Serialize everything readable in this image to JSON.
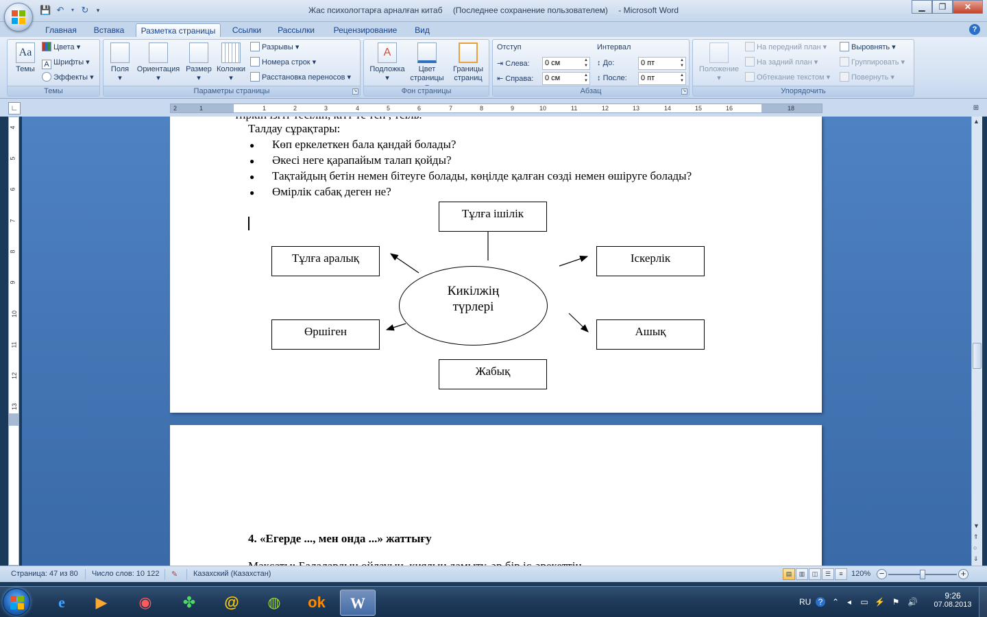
{
  "window": {
    "title_doc": "Жас психологтарға арналған   китаб",
    "title_saved": "(Последнее сохранение пользователем)",
    "title_app": "- Microsoft Word"
  },
  "tabs": [
    "Главная",
    "Вставка",
    "Разметка страницы",
    "Ссылки",
    "Рассылки",
    "Рецензирование",
    "Вид"
  ],
  "active_tab": "Разметка страницы",
  "ribbon": {
    "themes": {
      "label": "Темы",
      "btn": "Темы",
      "colors": "Цвета",
      "fonts": "Шрифты",
      "effects": "Эффекты"
    },
    "page_setup": {
      "label": "Параметры страницы",
      "margins": "Поля",
      "orientation": "Ориентация",
      "size": "Размер",
      "columns": "Колонки",
      "breaks": "Разрывы",
      "line_numbers": "Номера строк",
      "hyphenation": "Расстановка переносов"
    },
    "background": {
      "label": "Фон страницы",
      "watermark": "Подложка",
      "page_color_1": "Цвет",
      "page_color_2": "страницы",
      "page_borders_1": "Границы",
      "page_borders_2": "страниц"
    },
    "paragraph": {
      "label": "Абзац",
      "indent_title": "Отступ",
      "left_label": "Слева:",
      "left_value": "0 см",
      "right_label": "Справа:",
      "right_value": "0 см",
      "spacing_title": "Интервал",
      "before_label": "До:",
      "before_value": "0 пт",
      "after_label": "После:",
      "after_value": "0 пт"
    },
    "arrange": {
      "label": "Упорядочить",
      "position": "Положение",
      "bring_front": "На передний план",
      "send_back": "На задний план",
      "text_wrap": "Обтекание текстом",
      "align": "Выровнять",
      "group": "Группировать",
      "rotate": "Повернуть"
    }
  },
  "document": {
    "cut_line": "тпркін ізгіт тесілін, кітт тс тсп , тсіль.",
    "heading": "Талдау сұрақтары:",
    "bullets": [
      "Көп еркелеткен бала қандай болады?",
      "Әкесі неге қарапайым талап қойды?",
      "Тақтайдың бетін немен бітеуге болады, көңілде қалған сөзді немен өшіруге болады?",
      "Өмірлік сабақ деген не?"
    ],
    "diagram": {
      "center_line1": "Кикілжің",
      "center_line2": "түрлері",
      "top": "Тұлға ішілік",
      "left_upper": "Тұлға аралық",
      "right_upper": "Іскерлік",
      "left_lower": "Өршіген",
      "right_lower": "Ашық",
      "bottom": "Жабық"
    },
    "next_heading": "4. «Егерде ..., мен онда ...» жаттығу",
    "next_cut": "Мақсаты: Балалардың ойлауын, қиялын дамыту, әр бір іс-әрекеттің"
  },
  "statusbar": {
    "page": "Страница: 47 из 80",
    "words": "Число слов: 10 122",
    "language": "Казахский (Казахстан)",
    "zoom": "120%"
  },
  "taskbar": {
    "lang": "RU",
    "time": "9:26",
    "date": "07.08.2013"
  }
}
